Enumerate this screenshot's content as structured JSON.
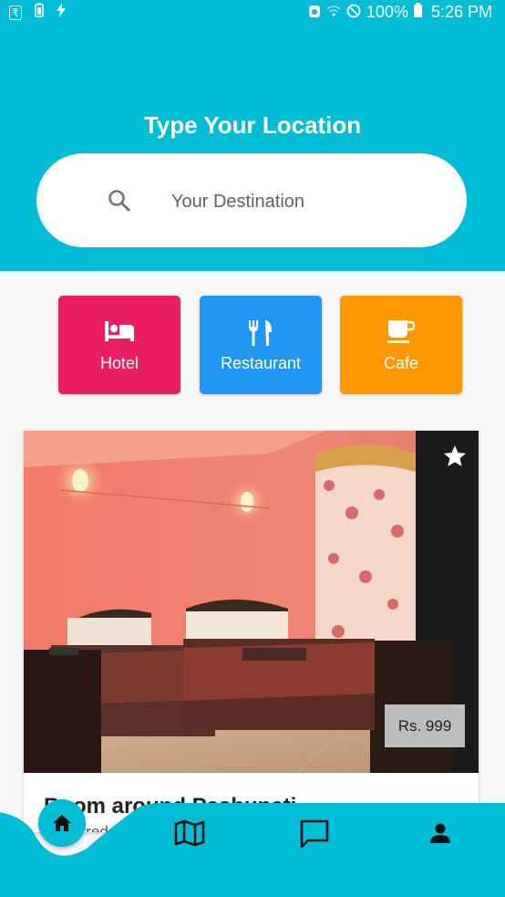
{
  "status_bar": {
    "left_icons": [
      "rupee-icon",
      "battery-saver-icon",
      "charging-icon"
    ],
    "right_icons": [
      "alarm-icon",
      "wifi-icon",
      "do-not-disturb-icon",
      "battery-icon"
    ],
    "battery": "100%",
    "time": "5:26 PM"
  },
  "header": {
    "title": "Type Your Location",
    "search_placeholder": "Your Destination",
    "search_icon": "search-icon",
    "background_color": "#00bcd4"
  },
  "categories": [
    {
      "label": "Hotel",
      "icon": "bed-icon",
      "color": "#e91e63"
    },
    {
      "label": "Restaurant",
      "icon": "restaurant-icon",
      "color": "#2196f3"
    },
    {
      "label": "Cafe",
      "icon": "cafe-icon",
      "color": "#ff9800"
    }
  ],
  "card": {
    "title": "Room around Pashupati",
    "subtitle": "Preferred",
    "price": "Rs. 999",
    "favorite_icon": "star-icon"
  },
  "bottom_nav": [
    {
      "name": "home",
      "icon": "home-icon",
      "active": true
    },
    {
      "name": "map",
      "icon": "map-icon",
      "active": false
    },
    {
      "name": "chat",
      "icon": "chat-icon",
      "active": false
    },
    {
      "name": "profile",
      "icon": "person-icon",
      "active": false
    }
  ]
}
